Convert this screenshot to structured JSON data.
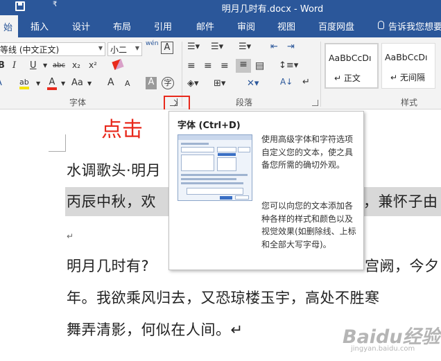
{
  "title_bar": {
    "document_title": "明月几时有.docx - Word",
    "save_icon": "save-icon",
    "more_glyph": "₹"
  },
  "tabs": [
    {
      "label": "始",
      "active": true
    },
    {
      "label": "插入"
    },
    {
      "label": "设计"
    },
    {
      "label": "布局"
    },
    {
      "label": "引用"
    },
    {
      "label": "邮件"
    },
    {
      "label": "审阅"
    },
    {
      "label": "视图"
    },
    {
      "label": "百度网盘"
    }
  ],
  "tell_me": {
    "label": "告诉我您想要",
    "icon": "lightbulb-icon"
  },
  "font_group": {
    "font_name": "等线 (中文正文)",
    "font_size": "小二",
    "wen_glyph": "wén",
    "border_char_label": "A",
    "bold": "B",
    "italic": "I",
    "underline": "U",
    "strikethrough": "abc",
    "subscript": "x₂",
    "superscript": "x²",
    "eraser_icon": "clear-formatting-icon",
    "text_effect": "A",
    "highlight": "ab",
    "font_color": "A",
    "change_case": "Aa",
    "grow_font": "A",
    "shrink_font": "A",
    "shading_char": "A",
    "enclose_char": "字",
    "group_label": "字体",
    "highlight_color": "#f6e40a",
    "font_color_value": "#e8291c"
  },
  "paragraph_group": {
    "group_label": "段落"
  },
  "styles_group": {
    "group_label": "样式",
    "items": [
      {
        "sample": "AaBbCcDı",
        "name": "↵ 正文"
      },
      {
        "sample": "AaBbCcDı",
        "name": "↵ 无间隔"
      }
    ]
  },
  "tooltip": {
    "title": "字体 (Ctrl+D)",
    "description_1": "使用高级字体和字符选项自定义您的文本，使之具备您所需的确切外观。",
    "description_2": "您可以向您的文本添加各种各样的样式和颜色以及视觉效果(如删除线、上标和全部大写字母)。"
  },
  "annotation": {
    "text": "点击",
    "color": "#e8291c"
  },
  "document": {
    "lines": [
      "水调歌头·明月",
      "丙辰中秋，欢",
      "，兼怀子由",
      "↵",
      "明月几时有?",
      "宫阙，今夕",
      "年。我欲乘风归去，又恐琼楼玉宇，高处不胜寒",
      "舞弄清影，何似在人间。↵"
    ]
  },
  "watermark": {
    "brand": "Baidu经验",
    "url": "jingyan.baidu.com"
  },
  "colors": {
    "accent": "#2b579a",
    "ribbon_bg": "#f3f3f3",
    "highlight_line": "#d8d8d8",
    "annotation_red": "#e8291c"
  }
}
